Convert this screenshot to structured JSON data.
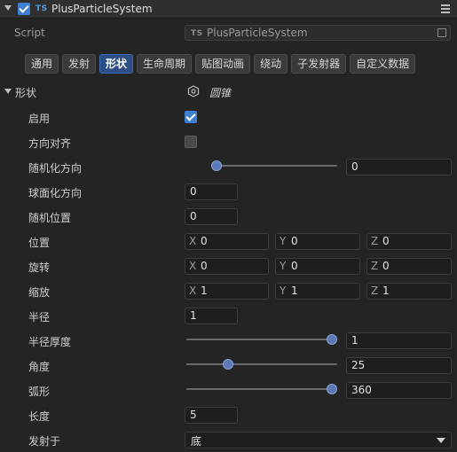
{
  "component": {
    "title": "PlusParticleSystem",
    "badge": "TS",
    "enabled": true
  },
  "script": {
    "label": "Script",
    "badge": "TS",
    "value": "PlusParticleSystem"
  },
  "tabs": [
    {
      "label": "通用",
      "active": false
    },
    {
      "label": "发射",
      "active": false
    },
    {
      "label": "形状",
      "active": true
    },
    {
      "label": "生命周期",
      "active": false
    },
    {
      "label": "贴图动画",
      "active": false
    },
    {
      "label": "绕动",
      "active": false
    },
    {
      "label": "子发射器",
      "active": false
    },
    {
      "label": "自定义数据",
      "active": false
    }
  ],
  "section": {
    "title": "形状",
    "shape_icon": "hexagon-icon",
    "shape_value": "圆锥"
  },
  "props": {
    "enabled": {
      "label": "启用",
      "checked": true
    },
    "align_direction": {
      "label": "方向对齐",
      "checked": false
    },
    "random_direction": {
      "label": "随机化方向",
      "value": "0",
      "fraction": 0.0
    },
    "spherize_direction": {
      "label": "球面化方向",
      "value": "0"
    },
    "random_position": {
      "label": "随机位置",
      "value": "0"
    },
    "position": {
      "label": "位置",
      "x_label": "X",
      "x": "0",
      "y_label": "Y",
      "y": "0",
      "z_label": "Z",
      "z": "0"
    },
    "rotation": {
      "label": "旋转",
      "x_label": "X",
      "x": "0",
      "y_label": "Y",
      "y": "0",
      "z_label": "Z",
      "z": "0"
    },
    "scale": {
      "label": "缩放",
      "x_label": "X",
      "x": "1",
      "y_label": "Y",
      "y": "1",
      "z_label": "Z",
      "z": "1"
    },
    "radius": {
      "label": "半径",
      "value": "1"
    },
    "radius_thickness": {
      "label": "半径厚度",
      "value": "1",
      "fraction": 1.0
    },
    "angle": {
      "label": "角度",
      "value": "25",
      "fraction": 0.2778
    },
    "arc": {
      "label": "弧形",
      "value": "360",
      "fraction": 1.0
    },
    "length": {
      "label": "长度",
      "value": "5"
    },
    "emit_from": {
      "label": "发射于",
      "value": "底"
    }
  },
  "colors": {
    "accent": "#3f7fd1",
    "active_tab": "#2b4e86",
    "slider_knob": "#5d78b6"
  }
}
